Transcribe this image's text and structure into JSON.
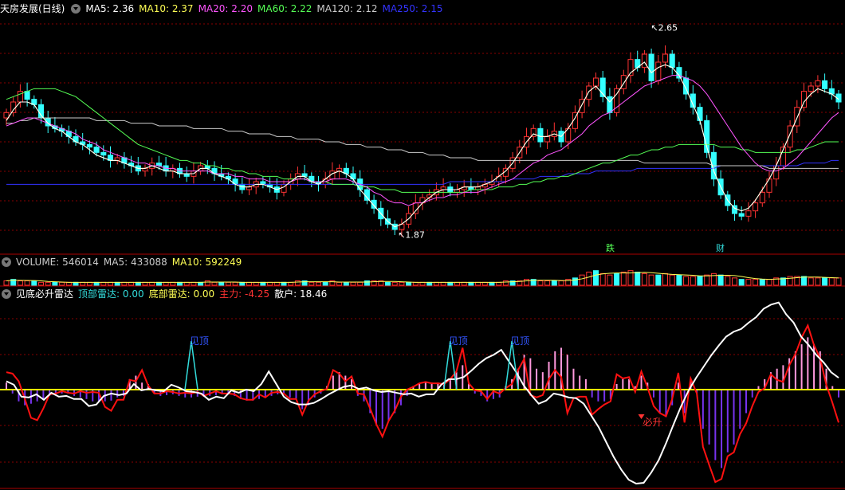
{
  "panel1": {
    "title": "天房发展(日线)",
    "ma": [
      {
        "label": "MA5: 2.36",
        "color": "#ffffff"
      },
      {
        "label": "MA10: 2.37",
        "color": "#ffff55"
      },
      {
        "label": "MA20: 2.20",
        "color": "#ff55ff"
      },
      {
        "label": "MA60: 2.22",
        "color": "#55ff55"
      },
      {
        "label": "MA120: 2.12",
        "color": "#cccccc"
      },
      {
        "label": "MA250: 2.15",
        "color": "#3333ff"
      }
    ],
    "high_label": "2.65",
    "low_label": "1.87",
    "badge1": "跌",
    "badge2": "财"
  },
  "panel2": {
    "items": [
      {
        "label": "VOLUME: 546014",
        "color": "#cccccc"
      },
      {
        "label": "MA5: 433088",
        "color": "#cccccc"
      },
      {
        "label": "MA10: 592249",
        "color": "#ffff55"
      }
    ]
  },
  "panel3": {
    "title": "见底必升雷达",
    "items": [
      {
        "label": "顶部雷达: 0.00",
        "color": "#33dddd"
      },
      {
        "label": "底部雷达: 0.00",
        "color": "#ffff55"
      },
      {
        "label": "主力: -4.25",
        "color": "#ff3333"
      },
      {
        "label": "散户: 18.46",
        "color": "#ffffff"
      }
    ],
    "signal_top": "见顶",
    "signal_bottom": "必升"
  },
  "colors": {
    "up": "#ff3333",
    "down": "#33ffff",
    "grid": "#8a0000",
    "ma5": "#ffffff",
    "ma10": "#ffff55",
    "ma20": "#ff55ff",
    "ma60": "#55ff55",
    "ma120": "#cccccc",
    "ma250": "#3333ff"
  },
  "chart_data": [
    {
      "type": "candlestick",
      "ylim": [
        1.8,
        2.7
      ],
      "annotations": [
        {
          "text": "2.65",
          "value": 2.65
        },
        {
          "text": "1.87",
          "value": 1.87
        }
      ],
      "close": [
        2.33,
        2.37,
        2.41,
        2.38,
        2.36,
        2.31,
        2.28,
        2.27,
        2.26,
        2.24,
        2.22,
        2.21,
        2.2,
        2.18,
        2.17,
        2.15,
        2.16,
        2.14,
        2.13,
        2.11,
        2.12,
        2.14,
        2.13,
        2.11,
        2.12,
        2.1,
        2.09,
        2.11,
        2.13,
        2.12,
        2.1,
        2.09,
        2.08,
        2.06,
        2.04,
        2.05,
        2.07,
        2.06,
        2.05,
        2.03,
        2.06,
        2.08,
        2.1,
        2.09,
        2.07,
        2.06,
        2.08,
        2.11,
        2.12,
        2.1,
        2.08,
        2.04,
        2.0,
        1.97,
        1.93,
        1.91,
        1.89,
        1.91,
        1.95,
        1.99,
        2.01,
        2.02,
        2.04,
        2.05,
        2.03,
        2.04,
        2.05,
        2.04,
        2.05,
        2.06,
        2.07,
        2.09,
        2.12,
        2.16,
        2.2,
        2.24,
        2.27,
        2.22,
        2.24,
        2.26,
        2.22,
        2.27,
        2.33,
        2.38,
        2.43,
        2.46,
        2.39,
        2.33,
        2.42,
        2.47,
        2.53,
        2.5,
        2.55,
        2.45,
        2.52,
        2.55,
        2.5,
        2.46,
        2.4,
        2.35,
        2.3,
        2.18,
        2.08,
        2.02,
        1.98,
        1.95,
        1.94,
        1.96,
        1.99,
        2.03,
        2.08,
        2.13,
        2.2,
        2.28,
        2.35,
        2.41,
        2.43,
        2.45,
        2.42,
        2.4,
        2.37
      ],
      "ma5": [
        2.3,
        2.34,
        2.37,
        2.37,
        2.36,
        2.32,
        2.29,
        2.27,
        2.26,
        2.24,
        2.22,
        2.21,
        2.19,
        2.17,
        2.16,
        2.15,
        2.15,
        2.14,
        2.13,
        2.12,
        2.12,
        2.13,
        2.12,
        2.11,
        2.11,
        2.1,
        2.1,
        2.1,
        2.12,
        2.12,
        2.1,
        2.09,
        2.08,
        2.06,
        2.05,
        2.05,
        2.06,
        2.06,
        2.05,
        2.04,
        2.05,
        2.07,
        2.09,
        2.09,
        2.07,
        2.06,
        2.08,
        2.1,
        2.11,
        2.1,
        2.08,
        2.04,
        2.01,
        1.98,
        1.95,
        1.92,
        1.9,
        1.91,
        1.93,
        1.96,
        1.99,
        2.01,
        2.03,
        2.04,
        2.04,
        2.04,
        2.05,
        2.05,
        2.05,
        2.06,
        2.07,
        2.09,
        2.11,
        2.14,
        2.18,
        2.22,
        2.25,
        2.24,
        2.24,
        2.25,
        2.24,
        2.27,
        2.31,
        2.36,
        2.41,
        2.43,
        2.4,
        2.37,
        2.4,
        2.44,
        2.48,
        2.5,
        2.52,
        2.48,
        2.5,
        2.51,
        2.5,
        2.47,
        2.42,
        2.36,
        2.3,
        2.2,
        2.11,
        2.05,
        2.0,
        1.97,
        1.96,
        1.97,
        2.0,
        2.04,
        2.08,
        2.13,
        2.19,
        2.25,
        2.31,
        2.37,
        2.4,
        2.42,
        2.41,
        2.4,
        2.38
      ],
      "ma20": [
        2.28,
        2.29,
        2.3,
        2.31,
        2.31,
        2.3,
        2.29,
        2.28,
        2.27,
        2.26,
        2.25,
        2.23,
        2.22,
        2.21,
        2.19,
        2.18,
        2.17,
        2.16,
        2.15,
        2.14,
        2.14,
        2.13,
        2.13,
        2.12,
        2.12,
        2.11,
        2.11,
        2.11,
        2.11,
        2.11,
        2.1,
        2.1,
        2.1,
        2.09,
        2.09,
        2.08,
        2.08,
        2.08,
        2.07,
        2.07,
        2.07,
        2.07,
        2.08,
        2.08,
        2.07,
        2.07,
        2.07,
        2.08,
        2.08,
        2.08,
        2.07,
        2.06,
        2.05,
        2.03,
        2.02,
        2.0,
        1.99,
        1.99,
        1.98,
        1.99,
        1.99,
        2.0,
        2.01,
        2.01,
        2.02,
        2.02,
        2.03,
        2.03,
        2.03,
        2.04,
        2.05,
        2.06,
        2.07,
        2.08,
        2.1,
        2.12,
        2.14,
        2.15,
        2.17,
        2.18,
        2.19,
        2.21,
        2.23,
        2.25,
        2.28,
        2.3,
        2.32,
        2.33,
        2.35,
        2.37,
        2.39,
        2.41,
        2.43,
        2.44,
        2.45,
        2.46,
        2.47,
        2.47,
        2.46,
        2.45,
        2.43,
        2.4,
        2.36,
        2.32,
        2.28,
        2.24,
        2.2,
        2.17,
        2.14,
        2.12,
        2.11,
        2.11,
        2.12,
        2.14,
        2.16,
        2.19,
        2.22,
        2.25,
        2.28,
        2.31,
        2.33
      ],
      "ma60": [
        2.38,
        2.39,
        2.4,
        2.41,
        2.42,
        2.42,
        2.42,
        2.42,
        2.41,
        2.4,
        2.39,
        2.37,
        2.35,
        2.33,
        2.31,
        2.29,
        2.27,
        2.25,
        2.23,
        2.21,
        2.2,
        2.19,
        2.18,
        2.17,
        2.16,
        2.15,
        2.15,
        2.14,
        2.14,
        2.13,
        2.13,
        2.12,
        2.12,
        2.11,
        2.11,
        2.1,
        2.1,
        2.09,
        2.09,
        2.09,
        2.08,
        2.08,
        2.08,
        2.08,
        2.07,
        2.07,
        2.07,
        2.06,
        2.06,
        2.06,
        2.06,
        2.05,
        2.05,
        2.05,
        2.04,
        2.04,
        2.04,
        2.03,
        2.03,
        2.03,
        2.03,
        2.03,
        2.03,
        2.03,
        2.03,
        2.03,
        2.03,
        2.04,
        2.04,
        2.04,
        2.04,
        2.05,
        2.05,
        2.05,
        2.06,
        2.06,
        2.07,
        2.07,
        2.08,
        2.08,
        2.09,
        2.09,
        2.1,
        2.11,
        2.12,
        2.13,
        2.14,
        2.14,
        2.15,
        2.16,
        2.17,
        2.17,
        2.18,
        2.19,
        2.19,
        2.2,
        2.2,
        2.21,
        2.21,
        2.21,
        2.21,
        2.21,
        2.21,
        2.2,
        2.2,
        2.2,
        2.19,
        2.19,
        2.18,
        2.18,
        2.18,
        2.18,
        2.18,
        2.18,
        2.19,
        2.19,
        2.2,
        2.21,
        2.22,
        2.22,
        2.22
      ],
      "ma120": [
        2.29,
        2.29,
        2.3,
        2.3,
        2.31,
        2.31,
        2.31,
        2.31,
        2.31,
        2.31,
        2.31,
        2.31,
        2.31,
        2.3,
        2.3,
        2.3,
        2.3,
        2.3,
        2.29,
        2.29,
        2.29,
        2.29,
        2.28,
        2.28,
        2.28,
        2.28,
        2.28,
        2.27,
        2.27,
        2.27,
        2.27,
        2.27,
        2.26,
        2.26,
        2.26,
        2.25,
        2.25,
        2.25,
        2.25,
        2.24,
        2.24,
        2.24,
        2.23,
        2.23,
        2.23,
        2.23,
        2.22,
        2.22,
        2.22,
        2.21,
        2.21,
        2.21,
        2.2,
        2.2,
        2.2,
        2.19,
        2.19,
        2.19,
        2.18,
        2.18,
        2.18,
        2.17,
        2.17,
        2.17,
        2.16,
        2.16,
        2.16,
        2.16,
        2.15,
        2.15,
        2.15,
        2.15,
        2.15,
        2.15,
        2.15,
        2.15,
        2.15,
        2.15,
        2.15,
        2.15,
        2.15,
        2.15,
        2.15,
        2.15,
        2.15,
        2.15,
        2.15,
        2.15,
        2.15,
        2.15,
        2.15,
        2.15,
        2.14,
        2.14,
        2.14,
        2.14,
        2.14,
        2.14,
        2.14,
        2.14,
        2.14,
        2.14,
        2.13,
        2.13,
        2.13,
        2.13,
        2.13,
        2.13,
        2.13,
        2.13,
        2.12,
        2.12,
        2.12,
        2.12,
        2.12,
        2.12,
        2.12,
        2.12,
        2.12,
        2.12,
        2.12
      ],
      "ma250": [
        2.06,
        2.06,
        2.06,
        2.06,
        2.06,
        2.06,
        2.06,
        2.06,
        2.06,
        2.06,
        2.06,
        2.06,
        2.06,
        2.06,
        2.06,
        2.06,
        2.06,
        2.06,
        2.06,
        2.06,
        2.06,
        2.06,
        2.06,
        2.06,
        2.06,
        2.06,
        2.06,
        2.06,
        2.06,
        2.06,
        2.06,
        2.06,
        2.06,
        2.06,
        2.06,
        2.06,
        2.06,
        2.06,
        2.06,
        2.06,
        2.06,
        2.06,
        2.06,
        2.06,
        2.06,
        2.06,
        2.06,
        2.06,
        2.06,
        2.06,
        2.06,
        2.06,
        2.06,
        2.06,
        2.06,
        2.06,
        2.06,
        2.06,
        2.06,
        2.06,
        2.06,
        2.06,
        2.06,
        2.06,
        2.07,
        2.07,
        2.07,
        2.07,
        2.07,
        2.07,
        2.07,
        2.07,
        2.07,
        2.08,
        2.08,
        2.08,
        2.08,
        2.09,
        2.09,
        2.09,
        2.09,
        2.1,
        2.1,
        2.1,
        2.1,
        2.11,
        2.11,
        2.11,
        2.11,
        2.11,
        2.11,
        2.12,
        2.12,
        2.12,
        2.12,
        2.12,
        2.12,
        2.12,
        2.12,
        2.12,
        2.12,
        2.12,
        2.12,
        2.13,
        2.13,
        2.13,
        2.13,
        2.13,
        2.13,
        2.13,
        2.13,
        2.13,
        2.13,
        2.13,
        2.13,
        2.14,
        2.14,
        2.14,
        2.14,
        2.15,
        2.15
      ]
    },
    {
      "type": "bar",
      "volume": [
        3,
        4,
        3,
        3,
        3,
        2,
        2,
        2,
        2,
        2,
        2,
        2,
        2,
        2,
        2,
        2,
        2,
        2,
        2,
        2,
        2,
        2,
        2,
        2,
        2,
        2,
        2,
        2,
        2,
        3,
        2,
        2,
        2,
        2,
        2,
        2,
        2,
        2,
        2,
        2,
        2,
        2,
        3,
        3,
        2,
        2,
        2,
        3,
        2,
        2,
        2,
        2,
        3,
        3,
        3,
        2,
        2,
        2,
        2,
        2,
        2,
        2,
        2,
        2,
        2,
        2,
        2,
        2,
        2,
        2,
        2,
        2,
        3,
        3,
        3,
        4,
        4,
        3,
        3,
        3,
        3,
        4,
        5,
        7,
        9,
        10,
        8,
        7,
        8,
        9,
        10,
        9,
        8,
        7,
        7,
        8,
        7,
        7,
        6,
        6,
        6,
        7,
        8,
        7,
        6,
        5,
        4,
        4,
        4,
        4,
        4,
        5,
        5,
        6,
        6,
        6,
        5,
        5,
        5,
        5,
        5
      ],
      "ylim": [
        0,
        12
      ]
    },
    {
      "type": "indicator",
      "ylim": [
        -12,
        12
      ],
      "zhuli": [
        2.5,
        2.3,
        1.2,
        -1.2,
        -3.6,
        -3.9,
        -2.4,
        -0.6,
        -0.5,
        -0.2,
        -0.4,
        -0.5,
        -0.2,
        -0.4,
        -0.3,
        -0.4,
        -2.2,
        -2.7,
        -1.3,
        -1.3,
        1.4,
        1.2,
        2.8,
        0.6,
        -0.5,
        -0.5,
        -0.2,
        -0.3,
        -0.5,
        -0.4,
        -0.5,
        -0.3,
        -0.8,
        -0.5,
        -0.2,
        -0.5,
        -0.5,
        -0.6,
        -1.1,
        -1.3,
        -1.3,
        -0.6,
        -1.0,
        -0.4,
        -0.3,
        -0.5,
        -1.2,
        -1.2,
        -3.2,
        -1.4,
        -0.6,
        -0.2,
        0.1,
        2.8,
        2.3,
        1.2,
        1.9,
        -0.5,
        -0.6,
        -2.4,
        -4.4,
        -6.0,
        -4.0,
        -2.7,
        -0.9,
        0.0,
        0.4,
        0.9,
        1.1,
        0.9,
        0.9,
        0.8,
        1.5,
        2.6,
        6.0,
        0.9,
        -0.1,
        -0.2,
        -1.2,
        -0.2,
        -0.5,
        0.2,
        0.8,
        2.8,
        4.4,
        -0.7,
        -1.0,
        -0.7,
        1.5,
        2.8,
        1.8,
        -3.0,
        -1.1,
        -0.9,
        -0.9,
        -3.2,
        -2.5,
        -1.9,
        -1.5,
        2.2,
        1.6,
        1.8,
        -0.3,
        2.6,
        0.3,
        -2.1,
        -3.0,
        -3.4,
        -1.2,
        2.4,
        -4.2,
        1.6,
        -0.5,
        -7.3,
        -9.6,
        -11.8,
        -11.4,
        -8.5,
        -8.0,
        -5.7,
        -4.3,
        -2.1,
        -0.3,
        0.2,
        2.2,
        1.4,
        1.1,
        3.5,
        5.1,
        7.5,
        9.2,
        6.4,
        4.5,
        0.7,
        -1.7,
        -4.2
      ],
      "sanhu": [
        1.2,
        0.7,
        -0.9,
        -1.0,
        -0.6,
        -1.3,
        -0.4,
        -0.9,
        -0.8,
        -1.2,
        -1.2,
        -2.1,
        -1.9,
        -0.8,
        -0.5,
        -0.7,
        -0.5,
        0.8,
        -0.1,
        0.1,
        -0.1,
        -0.2,
        0.7,
        0.3,
        -0.2,
        -0.3,
        -0.5,
        -1.3,
        -0.9,
        -1.1,
        -0.1,
        -0.4,
        0.0,
        -0.2,
        0.8,
        2.6,
        0.8,
        -0.9,
        -1.6,
        -1.9,
        -1.9,
        -1.7,
        -1.2,
        -0.6,
        -0.1,
        0.4,
        0.6,
        0.1,
        0.3,
        -0.1,
        -0.3,
        -0.2,
        -0.4,
        -0.6,
        -0.5,
        -0.9,
        -0.6,
        -0.6,
        0.7,
        1.5,
        1.5,
        1.8,
        2.7,
        3.7,
        4.5,
        5.0,
        5.7,
        4.1,
        2.5,
        0.6,
        -0.7,
        -1.8,
        -1.4,
        -0.5,
        -0.7,
        -1.0,
        -1.1,
        -1.8,
        -3.3,
        -4.8,
        -6.7,
        -8.6,
        -10.2,
        -11.5,
        -12.0,
        -11.9,
        -10.6,
        -9.0,
        -6.8,
        -4.4,
        -2.1,
        -0.1,
        1.7,
        3.3,
        4.9,
        6.3,
        7.6,
        8.3,
        8.7,
        9.6,
        10.4,
        11.6,
        12.2,
        12.5,
        10.8,
        9.6,
        7.6,
        6.4,
        5.0,
        3.9,
        2.5,
        1.7
      ],
      "bars": [
        1.0,
        -0.5,
        -1.5,
        -2.0,
        -1.8,
        -1.5,
        -1.2,
        -0.8,
        -0.6,
        -0.5,
        -0.5,
        -0.8,
        -1.0,
        -1.2,
        -1.5,
        -1.5,
        -1.5,
        -1.4,
        -1.0,
        -0.8,
        1.5,
        2.0,
        1.0,
        0.8,
        -0.5,
        -0.8,
        -0.7,
        -0.6,
        -0.8,
        -1.0,
        -1.0,
        -0.9,
        -0.9,
        -0.8,
        -0.7,
        -0.6,
        -0.6,
        -0.8,
        -1.2,
        -1.4,
        -1.4,
        -1.2,
        -1.0,
        -0.8,
        -0.6,
        -0.5,
        -1.0,
        -1.2,
        -2.5,
        -2.0,
        -1.0,
        -0.5,
        0.5,
        2.0,
        2.5,
        2.0,
        1.5,
        -0.8,
        -1.5,
        -3.0,
        -4.5,
        -5.0,
        -4.0,
        -3.0,
        -2.0,
        -0.8,
        0.5,
        0.8,
        1.0,
        1.0,
        1.0,
        0.8,
        1.5,
        2.5,
        3.5,
        1.0,
        -0.5,
        -0.8,
        -1.5,
        -1.2,
        -1.0,
        0.5,
        1.5,
        3.0,
        5.0,
        4.5,
        3.0,
        2.5,
        4.0,
        5.5,
        6.0,
        5.0,
        3.0,
        2.0,
        1.5,
        -1.0,
        -1.5,
        -1.5,
        -1.2,
        0.8,
        1.5,
        1.5,
        0.5,
        2.0,
        1.0,
        -1.0,
        -3.0,
        -3.5,
        -2.0,
        1.0,
        -3.0,
        1.5,
        -0.5,
        -5.0,
        -7.0,
        -9.0,
        -10.0,
        -8.0,
        -7.0,
        -5.0,
        -3.0,
        -1.0,
        0.5,
        1.5,
        2.5,
        3.0,
        3.5,
        4.5,
        5.5,
        6.5,
        7.5,
        6.5,
        5.5,
        3.0,
        0.5,
        -1.0
      ],
      "signals": [
        {
          "text": "见顶",
          "index": 30
        },
        {
          "text": "见顶",
          "index": 72
        },
        {
          "text": "见顶",
          "index": 82
        },
        {
          "text": "必升",
          "index": 103
        }
      ]
    }
  ]
}
